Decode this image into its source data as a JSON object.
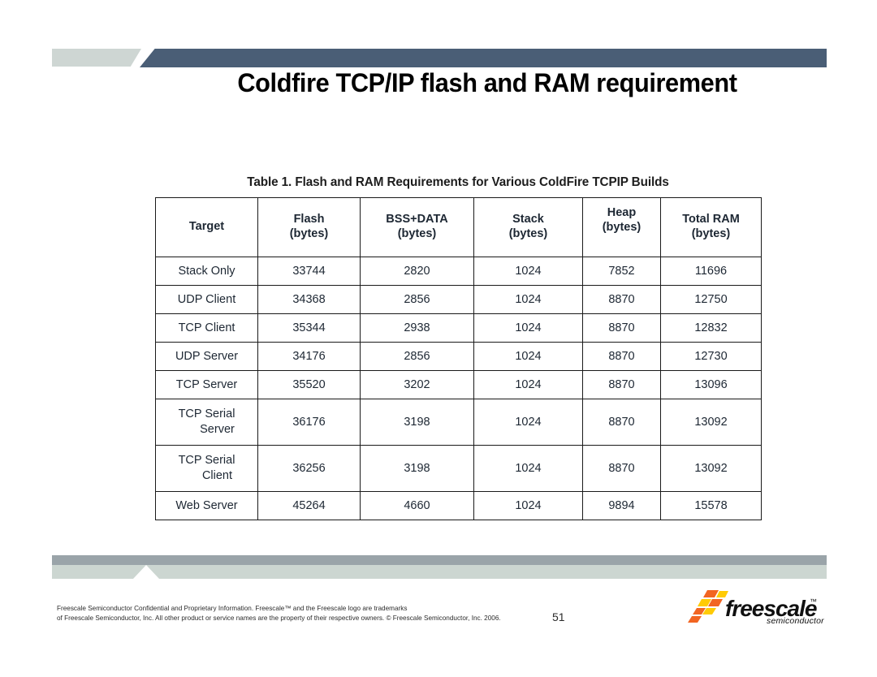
{
  "slide": {
    "title": "Coldfire TCP/IP flash and RAM requirement",
    "page_number": "51",
    "colors": {
      "banner_dark_blue": "#4a5e76",
      "banner_light_green_gray": "#ced6d3",
      "bottom_bar_gray": "#9aa4a9",
      "bottom_band_light": "#ccd6d1",
      "logo_orange": "#f26522",
      "logo_yellow": "#ffcb05",
      "table_border": "#1a1a1a",
      "table_text": "#1d2733"
    }
  },
  "table": {
    "caption": "Table 1. Flash and RAM Requirements for Various ColdFire TCPIP Builds",
    "headers": [
      {
        "line1": "Target",
        "line2": ""
      },
      {
        "line1": "Flash",
        "line2": "(bytes)"
      },
      {
        "line1": "BSS+DATA",
        "line2": "(bytes)"
      },
      {
        "line1": "Stack",
        "line2": "(bytes)"
      },
      {
        "line1": "Heap",
        "line2": "(bytes)"
      },
      {
        "line1": "Total RAM",
        "line2": "(bytes)"
      }
    ],
    "rows": [
      {
        "target_l1": "Stack Only",
        "target_l2": "",
        "flash": "33744",
        "bss_data": "2820",
        "stack": "1024",
        "heap": "7852",
        "total_ram": "11696"
      },
      {
        "target_l1": "UDP Client",
        "target_l2": "",
        "flash": "34368",
        "bss_data": "2856",
        "stack": "1024",
        "heap": "8870",
        "total_ram": "12750"
      },
      {
        "target_l1": "TCP Client",
        "target_l2": "",
        "flash": "35344",
        "bss_data": "2938",
        "stack": "1024",
        "heap": "8870",
        "total_ram": "12832"
      },
      {
        "target_l1": "UDP Server",
        "target_l2": "",
        "flash": "34176",
        "bss_data": "2856",
        "stack": "1024",
        "heap": "8870",
        "total_ram": "12730"
      },
      {
        "target_l1": "TCP Server",
        "target_l2": "",
        "flash": "35520",
        "bss_data": "3202",
        "stack": "1024",
        "heap": "8870",
        "total_ram": "13096"
      },
      {
        "target_l1": "TCP Serial",
        "target_l2": "Server",
        "flash": "36176",
        "bss_data": "3198",
        "stack": "1024",
        "heap": "8870",
        "total_ram": "13092"
      },
      {
        "target_l1": "TCP Serial",
        "target_l2": "Client",
        "flash": "36256",
        "bss_data": "3198",
        "stack": "1024",
        "heap": "8870",
        "total_ram": "13092"
      },
      {
        "target_l1": "Web Server",
        "target_l2": "",
        "flash": "45264",
        "bss_data": "4660",
        "stack": "1024",
        "heap": "9894",
        "total_ram": "15578"
      }
    ]
  },
  "footer": {
    "line1": "Freescale Semiconductor Confidential and Proprietary Information. Freescale™ and the Freescale logo are trademarks",
    "line2": "of Freescale Semiconductor, Inc. All other product or service names are the property of their respective owners. © Freescale Semiconductor, Inc. 2006."
  },
  "logo": {
    "wordmark": "freescale",
    "trademark": "™",
    "subtitle": "semiconductor"
  }
}
